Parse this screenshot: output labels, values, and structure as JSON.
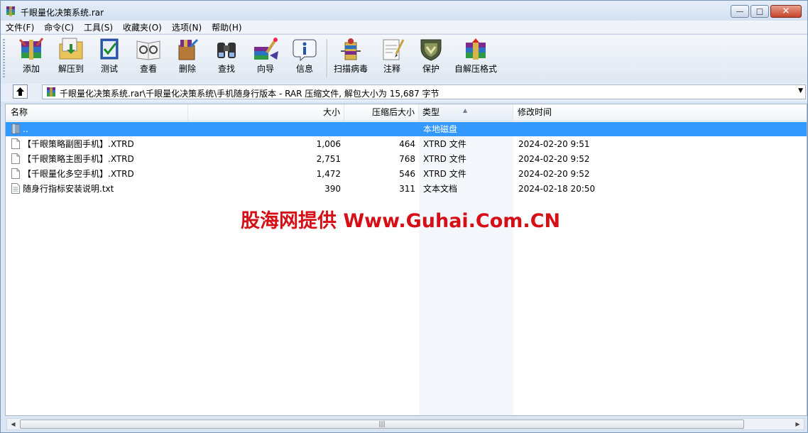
{
  "window": {
    "title": "千眼量化决策系统.rar",
    "minimize_glyph": "—",
    "maximize_glyph": "□",
    "close_glyph": "✕"
  },
  "menu": [
    "文件(F)",
    "命令(C)",
    "工具(S)",
    "收藏夹(O)",
    "选项(N)",
    "帮助(H)"
  ],
  "toolbar": [
    {
      "label": "添加",
      "icon": "add-archive-icon"
    },
    {
      "label": "解压到",
      "icon": "extract-to-icon"
    },
    {
      "label": "测试",
      "icon": "test-icon"
    },
    {
      "label": "查看",
      "icon": "view-icon"
    },
    {
      "label": "删除",
      "icon": "delete-icon"
    },
    {
      "label": "查找",
      "icon": "find-icon"
    },
    {
      "label": "向导",
      "icon": "wizard-icon"
    },
    {
      "label": "信息",
      "icon": "info-icon"
    },
    {
      "label": "扫描病毒",
      "icon": "virus-scan-icon"
    },
    {
      "label": "注释",
      "icon": "comment-icon"
    },
    {
      "label": "保护",
      "icon": "protect-icon"
    },
    {
      "label": "自解压格式",
      "icon": "sfx-icon"
    }
  ],
  "address": {
    "path": "千眼量化决策系统.rar\\千眼量化决策系统\\手机随身行版本 - RAR 压缩文件, 解包大小为 15,687 字节",
    "dropdown_glyph": "▼",
    "up_icon": "up-folder-icon"
  },
  "columns": {
    "name": "名称",
    "size": "大小",
    "packed": "压缩后大小",
    "type": "类型",
    "modified": "修改时间",
    "sort_glyph": "▲"
  },
  "rows": [
    {
      "name": "..",
      "size": "",
      "packed": "",
      "type": "本地磁盘",
      "modified": "",
      "icon": "parent-folder-icon",
      "selected": true
    },
    {
      "name": "【千眼策略副图手机】.XTRD",
      "size": "1,006",
      "packed": "464",
      "type": "XTRD 文件",
      "modified": "2024-02-20 9:51",
      "icon": "file-icon",
      "selected": false
    },
    {
      "name": "【千眼策略主图手机】.XTRD",
      "size": "2,751",
      "packed": "768",
      "type": "XTRD 文件",
      "modified": "2024-02-20 9:52",
      "icon": "file-icon",
      "selected": false
    },
    {
      "name": "【千眼量化多空手机】.XTRD",
      "size": "1,472",
      "packed": "546",
      "type": "XTRD 文件",
      "modified": "2024-02-20 9:52",
      "icon": "file-icon",
      "selected": false
    },
    {
      "name": "随身行指标安装说明.txt",
      "size": "390",
      "packed": "311",
      "type": "文本文档",
      "modified": "2024-02-18 20:50",
      "icon": "text-file-icon",
      "selected": false
    }
  ],
  "watermark": "股海网提供 Www.Guhai.Com.CN",
  "scrollbar": {
    "left_glyph": "◀",
    "right_glyph": "▶",
    "grip_glyph": "|||"
  },
  "colors": {
    "selection": "#3399ff",
    "watermark": "#d60f16"
  }
}
